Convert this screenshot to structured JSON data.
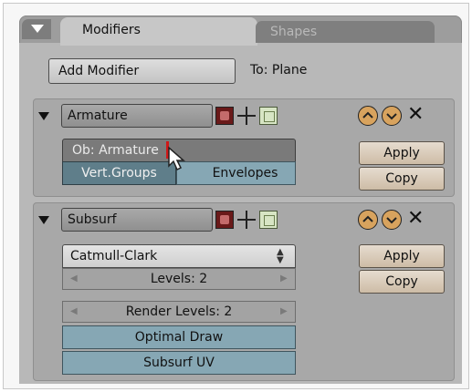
{
  "tabs": {
    "active": "Modifiers",
    "inactive": "Shapes"
  },
  "toolbar": {
    "add_modifier": "Add Modifier",
    "target": "To: Plane"
  },
  "armature": {
    "name": "Armature",
    "object_field": "Ob: Armature",
    "vert_groups": "Vert.Groups",
    "envelopes": "Envelopes",
    "apply": "Apply",
    "copy": "Copy"
  },
  "subsurf": {
    "name": "Subsurf",
    "algorithm": "Catmull-Clark",
    "levels": "Levels: 2",
    "render_levels": "Render Levels: 2",
    "optimal_draw": "Optimal Draw",
    "subsurf_uv": "Subsurf UV",
    "apply": "Apply",
    "copy": "Copy"
  },
  "colors": {
    "panel": "#b8b8b8",
    "teal": "#5f7e8a",
    "accent_orange": "#d8a35e",
    "cursor_red": "#d01818"
  }
}
